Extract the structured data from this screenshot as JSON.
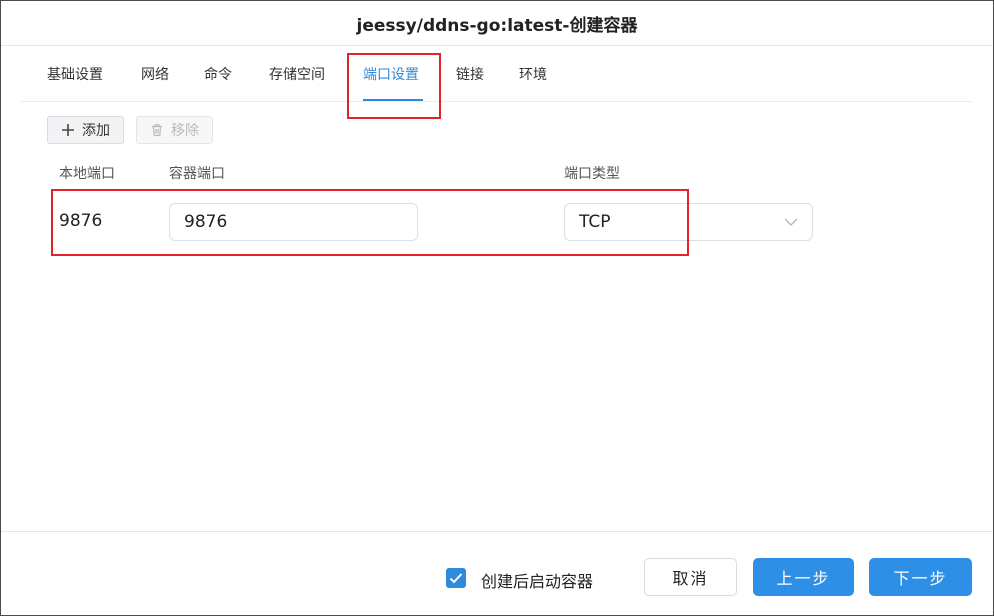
{
  "dialog": {
    "title": "jeessy/ddns-go:latest-创建容器"
  },
  "tabs": [
    {
      "label": "基础设置"
    },
    {
      "label": "网络"
    },
    {
      "label": "命令"
    },
    {
      "label": "存储空间"
    },
    {
      "label": "端口设置",
      "active": true
    },
    {
      "label": "链接"
    },
    {
      "label": "环境"
    }
  ],
  "toolbar": {
    "add_label": "添加",
    "remove_label": "移除"
  },
  "columns": {
    "local_port": "本地端口",
    "container_port": "容器端口",
    "port_type": "端口类型"
  },
  "port_rows": [
    {
      "local_port": "9876",
      "container_port": "9876",
      "port_type": "TCP"
    }
  ],
  "footer": {
    "start_after_create_label": "创建后启动容器",
    "start_after_create_checked": true,
    "cancel_label": "取消",
    "prev_label": "上一步",
    "next_label": "下一步"
  },
  "colors": {
    "accent": "#2e8bdc",
    "highlight": "#e0242b"
  }
}
